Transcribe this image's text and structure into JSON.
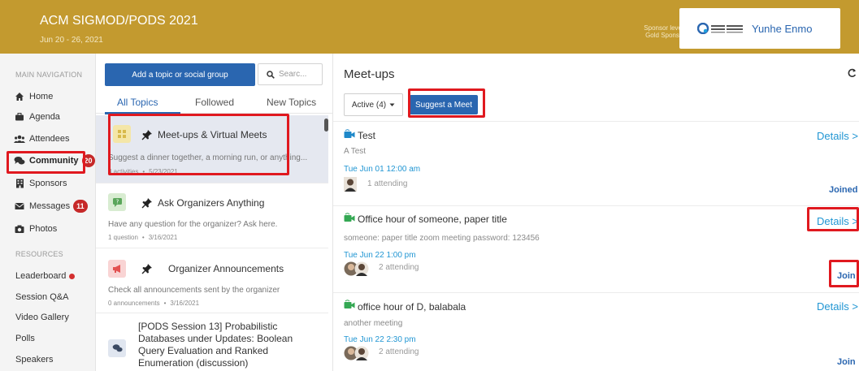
{
  "header": {
    "title": "ACM SIGMOD/PODS 2021",
    "dates": "Jun 20 - 26, 2021",
    "sponsor_level_line1": "Sponsor level:",
    "sponsor_level_line2": "Gold Sponsor",
    "sponsor_name": "Yunhe Enmo",
    "sponsor_logo_icon": "yunhe-enmo-logo"
  },
  "sidebar": {
    "main_heading": "MAIN NAVIGATION",
    "items": [
      {
        "label": "Home",
        "icon": "home-icon"
      },
      {
        "label": "Agenda",
        "icon": "briefcase-icon"
      },
      {
        "label": "Attendees",
        "icon": "users-icon"
      },
      {
        "label": "Community",
        "icon": "comments-icon",
        "badge": "20"
      },
      {
        "label": "Sponsors",
        "icon": "building-icon"
      },
      {
        "label": "Messages",
        "icon": "envelope-icon",
        "badge": "11"
      },
      {
        "label": "Photos",
        "icon": "camera-icon"
      }
    ],
    "resources_heading": "RESOURCES",
    "resources": [
      {
        "label": "Leaderboard"
      },
      {
        "label": "Session Q&A"
      },
      {
        "label": "Video Gallery"
      },
      {
        "label": "Polls"
      },
      {
        "label": "Speakers"
      }
    ]
  },
  "topics": {
    "add_button": "Add a topic or social group",
    "search_placeholder": "Searc...",
    "tabs": [
      "All Topics",
      "Followed",
      "New Topics"
    ],
    "items": [
      {
        "title": "Meet-ups & Virtual Meets",
        "desc": "Suggest a dinner together, a morning run, or anything...",
        "count": "3 activities",
        "date": "5/23/2021"
      },
      {
        "title": "Ask Organizers Anything",
        "desc": "Have any question for the organizer? Ask here.",
        "count": "1 question",
        "date": "3/16/2021"
      },
      {
        "title": "Organizer Announcements",
        "desc": "Check all announcements sent by the organizer",
        "count": "0 announcements",
        "date": "3/16/2021"
      },
      {
        "title": "[PODS Session 13] Probabilistic Databases under Updates: Boolean Query Evaluation and Ranked Enumeration (discussion)"
      }
    ]
  },
  "meetups": {
    "title": "Meet-ups",
    "active_filter": "Active (4)",
    "suggest_button": "Suggest a Meet",
    "details_label": "Details >",
    "items": [
      {
        "title": "Test",
        "desc": "A Test",
        "time": "Tue Jun 01 12:00 am",
        "attending": "1 attending",
        "status": "Joined"
      },
      {
        "title": "Office hour of someone, paper title",
        "desc": "someone: paper title zoom meeting password: 123456",
        "time": "Tue Jun 22 1:00 pm",
        "attending": "2 attending",
        "status": "Join"
      },
      {
        "title": "office hour of D, balabala",
        "desc": "another meeting",
        "time": "Tue Jun 22 2:30 pm",
        "attending": "2 attending",
        "status": "Join"
      }
    ]
  },
  "colors": {
    "header_bg": "#c39a2f",
    "primary_blue": "#2a66b0",
    "link_blue": "#2196d3",
    "annotation_red": "#e0191f",
    "badge_red": "#c62828"
  }
}
